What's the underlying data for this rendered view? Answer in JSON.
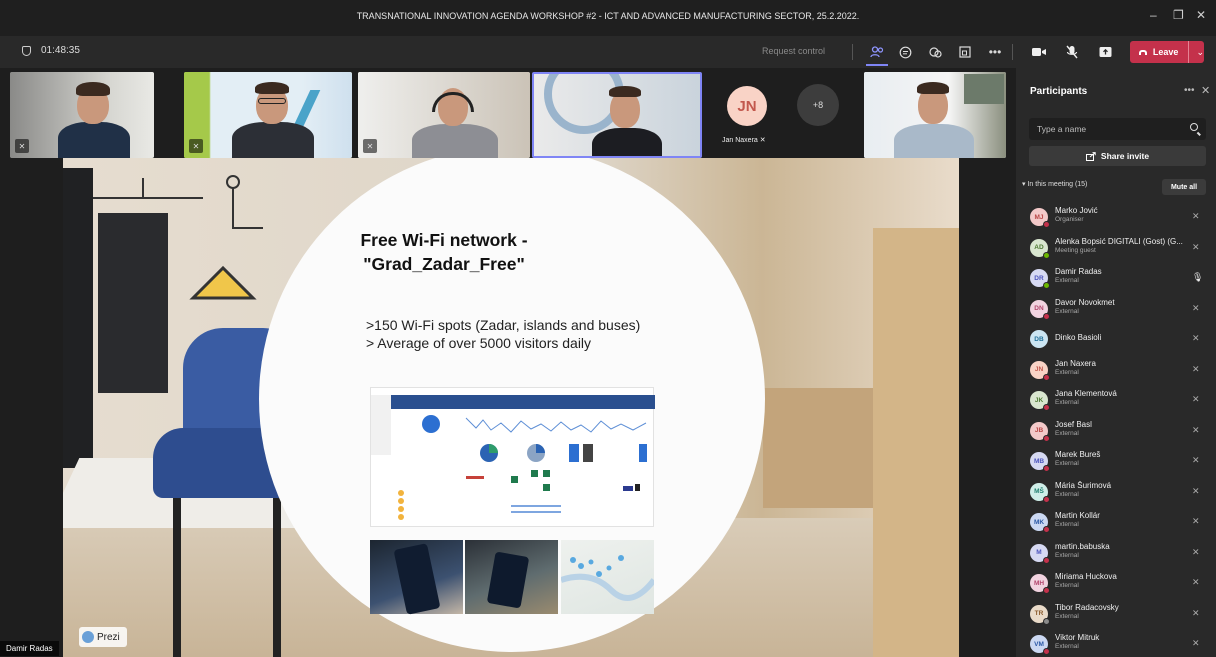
{
  "window": {
    "title": "TRANSNATIONAL INNOVATION AGENDA WORKSHOP #2 - ICT AND ADVANCED MANUFACTURING SECTOR, 25.2.2022.",
    "controls": {
      "minimize": "–",
      "maximize": "❐",
      "close": "✕"
    }
  },
  "toolbar": {
    "timer": "01:48:35",
    "request_control": "Request control",
    "leave_label": "Leave",
    "icons": [
      "people-icon",
      "chat-icon",
      "reactions-icon",
      "rooms-icon",
      "more-icon",
      "camera-icon",
      "mic-off-icon",
      "share-icon"
    ]
  },
  "video_strip": {
    "jan_initials": "JN",
    "jan_name": "Jan Naxera",
    "overflow_count": "+8"
  },
  "slide": {
    "title": "Free Wi-Fi network -\n\"Grad_Zadar_Free\"",
    "bullet_1": ">150 Wi-Fi spots (Zadar, islands and buses)",
    "bullet_2": "> Average of over 5000 visitors daily",
    "app_label": "Prezi",
    "presenter": "Damir Radas"
  },
  "panel": {
    "title": "Participants",
    "search_placeholder": "Type a name",
    "share_invite": "Share invite",
    "section": "In this meeting (15)",
    "mute_all": "Mute all",
    "participants": [
      {
        "initials": "MJ",
        "name": "Marko Jović",
        "role": "Organiser",
        "bg": "#f3c9c9",
        "fg": "#b84545",
        "status": "#c4314b",
        "mic": "muted"
      },
      {
        "initials": "AD",
        "name": "Alenka Bopsić DIGITALI (Gost) (G...",
        "role": "Meeting guest",
        "bg": "#d9e6cf",
        "fg": "#4e7a33",
        "status": "#6bb700",
        "mic": "muted"
      },
      {
        "initials": "DR",
        "name": "Damir Radas",
        "role": "External",
        "bg": "#d6d9f2",
        "fg": "#4b53bc",
        "status": "#6bb700",
        "mic": "active"
      },
      {
        "initials": "DN",
        "name": "Davor Novokmet",
        "role": "External",
        "bg": "#f2d3e0",
        "fg": "#b3466d",
        "status": "#c4314b",
        "mic": "muted"
      },
      {
        "initials": "DB",
        "name": "Dinko Basioli",
        "role": "",
        "bg": "#cbe5f2",
        "fg": "#1f6f99",
        "status": "",
        "mic": "muted"
      },
      {
        "initials": "JN",
        "name": "Jan Naxera",
        "role": "External",
        "bg": "#f9d3c6",
        "fg": "#c2584d",
        "status": "#c4314b",
        "mic": "muted"
      },
      {
        "initials": "JK",
        "name": "Jana Klementová",
        "role": "External",
        "bg": "#d9e6cf",
        "fg": "#4e7a33",
        "status": "#c4314b",
        "mic": "muted"
      },
      {
        "initials": "JB",
        "name": "Josef Basl",
        "role": "External",
        "bg": "#f3c9c9",
        "fg": "#b84545",
        "status": "#c4314b",
        "mic": "muted"
      },
      {
        "initials": "MB",
        "name": "Marek Bureš",
        "role": "External",
        "bg": "#d6d9f2",
        "fg": "#4b53bc",
        "status": "#c4314b",
        "mic": "muted"
      },
      {
        "initials": "MŠ",
        "name": "Mária Šurimová",
        "role": "External",
        "bg": "#cfeee8",
        "fg": "#1f7f6f",
        "status": "#c4314b",
        "mic": "muted"
      },
      {
        "initials": "MK",
        "name": "Martin Kollár",
        "role": "External",
        "bg": "#cbd8f2",
        "fg": "#2b58a5",
        "status": "#c4314b",
        "mic": "muted"
      },
      {
        "initials": "M",
        "name": "martin.babuska",
        "role": "External",
        "bg": "#d6d9f2",
        "fg": "#4b53bc",
        "status": "#c4314b",
        "mic": "muted"
      },
      {
        "initials": "MH",
        "name": "Miriama Huckova",
        "role": "External",
        "bg": "#f2d3e0",
        "fg": "#b3466d",
        "status": "#c4314b",
        "mic": "muted"
      },
      {
        "initials": "TR",
        "name": "Tibor Radacovsky",
        "role": "External",
        "bg": "#eadbc9",
        "fg": "#8a5a2b",
        "status": "#8a8a8a",
        "mic": "muted"
      },
      {
        "initials": "VM",
        "name": "Viktor Mitruk",
        "role": "External",
        "bg": "#cbd8f2",
        "fg": "#2b58a5",
        "status": "#c4314b",
        "mic": "muted"
      }
    ]
  }
}
